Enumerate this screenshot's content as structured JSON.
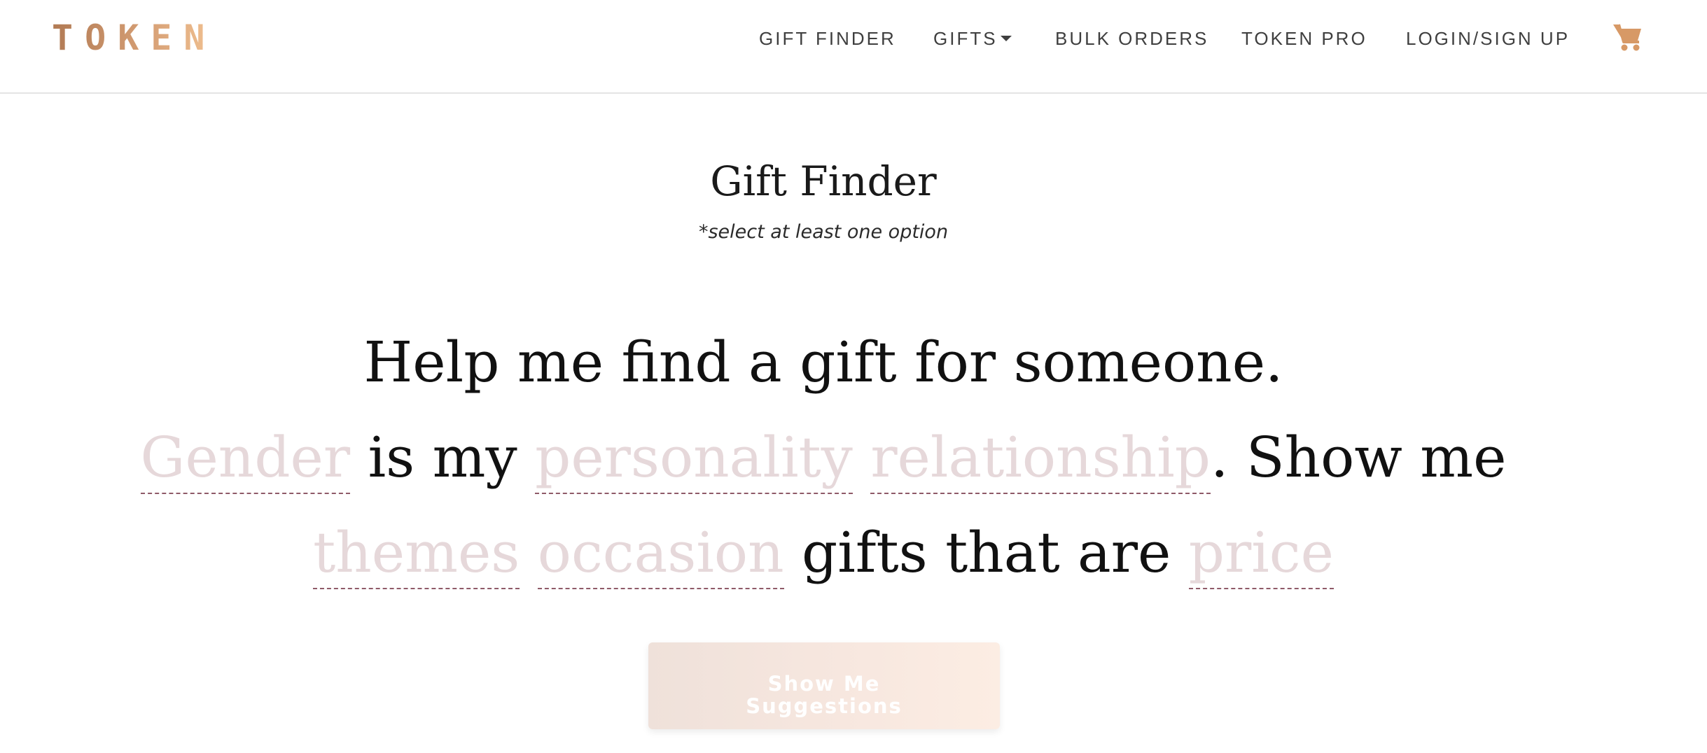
{
  "header": {
    "logo": "TOKEN",
    "nav": {
      "gift_finder": "GIFT FINDER",
      "gifts": "GIFTS",
      "bulk_orders": "BULK ORDERS",
      "token_pro": "TOKEN PRO",
      "login": "LOGIN/SIGN UP"
    },
    "cart_icon": "cart-icon"
  },
  "main": {
    "title": "Gift Finder",
    "subtitle": "*select at least one option",
    "sentence": {
      "intro": "Help me find a gift for someone.",
      "gender": "Gender",
      "is_my": "is my",
      "personality": "personality",
      "relationship": "relationship",
      "show_me": ". Show me",
      "themes": "themes",
      "occasion": "occasion",
      "gifts_that_are": "gifts that are",
      "price": "price"
    },
    "cta_label": "Show Me Suggestions"
  },
  "colors": {
    "brand_gradient_start": "#b17a54",
    "brand_gradient_end": "#f2c292",
    "placeholder_text": "#e6d8da",
    "underline": "#8f5a68",
    "cart": "#d79966"
  }
}
